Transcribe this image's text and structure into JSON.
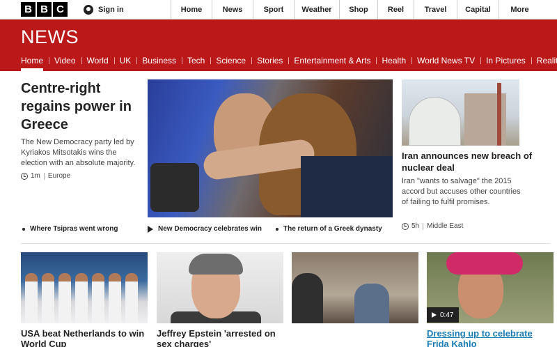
{
  "topbar": {
    "logo": [
      "B",
      "B",
      "C"
    ],
    "signin_label": "Sign in",
    "nav": [
      "Home",
      "News",
      "Sport",
      "Weather",
      "Shop",
      "Reel",
      "Travel",
      "Capital",
      "More"
    ]
  },
  "banner": {
    "wordmark": "NEWS",
    "color": "#bb1919",
    "subnav": [
      "Home",
      "Video",
      "World",
      "UK",
      "Business",
      "Tech",
      "Science",
      "Stories",
      "Entertainment & Arts",
      "Health",
      "World News TV",
      "In Pictures",
      "Reality"
    ]
  },
  "lead": {
    "title": "Centre-right regains power in Greece",
    "summary": "The New Democracy party led by Kyriakos Mitsotakis wins the election with an absolute majority.",
    "time": "1m",
    "section": "Europe"
  },
  "side_story": {
    "title": "Iran announces new breach of nuclear deal",
    "summary": "Iran \"wants to salvage\" the 2015 accord but accuses other countries of failing to fulfil promises.",
    "time": "5h",
    "section": "Middle East"
  },
  "related": [
    "Where Tsipras went wrong",
    "New Democracy celebrates win",
    "The return of a Greek dynasty"
  ],
  "bottom_stories": [
    {
      "title": "USA beat Netherlands to win World Cup"
    },
    {
      "title": "Jeffrey Epstein 'arrested on sex charges'"
    },
    {
      "title": ""
    },
    {
      "title": "Dressing up to celebrate Frida Kahlo",
      "video_duration": "0:47"
    }
  ]
}
